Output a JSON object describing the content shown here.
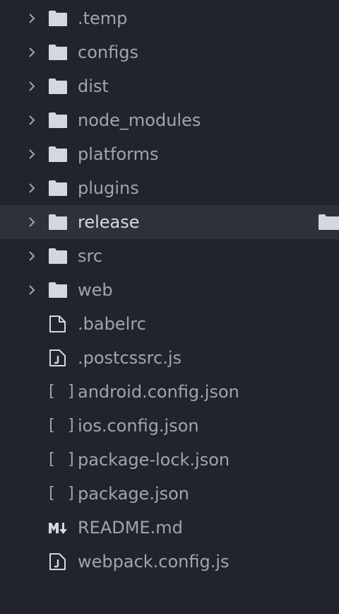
{
  "colors": {
    "background": "#21252b",
    "selected_row": "#2c313a",
    "text": "#9da5b4",
    "text_selected": "#d7dae0",
    "icon": "#d4d7dd"
  },
  "tree": {
    "folders": [
      {
        "name": ".temp",
        "icon": "folder-icon"
      },
      {
        "name": "configs",
        "icon": "folder-icon"
      },
      {
        "name": "dist",
        "icon": "folder-icon"
      },
      {
        "name": "node_modules",
        "icon": "folder-icon"
      },
      {
        "name": "platforms",
        "icon": "folder-icon"
      },
      {
        "name": "plugins",
        "icon": "folder-icon"
      },
      {
        "name": "release",
        "icon": "folder-icon",
        "selected": true
      },
      {
        "name": "src",
        "icon": "folder-icon"
      },
      {
        "name": "web",
        "icon": "folder-icon"
      }
    ],
    "files": [
      {
        "name": ".babelrc",
        "icon": "file-icon"
      },
      {
        "name": ".postcssrc.js",
        "icon": "js-file-icon"
      },
      {
        "name": "android.config.json",
        "icon": "json-file-icon"
      },
      {
        "name": "ios.config.json",
        "icon": "json-file-icon"
      },
      {
        "name": "package-lock.json",
        "icon": "json-file-icon"
      },
      {
        "name": "package.json",
        "icon": "json-file-icon"
      },
      {
        "name": "README.md",
        "icon": "markdown-file-icon"
      },
      {
        "name": "webpack.config.js",
        "icon": "js-file-icon"
      }
    ],
    "json_icon_glyph": "[ ]"
  }
}
